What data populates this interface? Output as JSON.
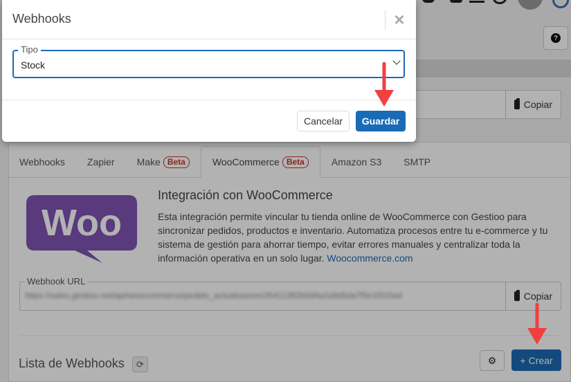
{
  "modal": {
    "title": "Webhooks",
    "close_symbol": "×",
    "type_legend": "Tipo",
    "type_value": "Stock",
    "cancel_label": "Cancelar",
    "save_label": "Guardar"
  },
  "background": {
    "copy_label": "Copiar",
    "help_symbol": "?",
    "tabs": [
      {
        "label": "Webhooks",
        "badge": ""
      },
      {
        "label": "Zapier",
        "badge": ""
      },
      {
        "label": "Make",
        "badge": "Beta"
      },
      {
        "label": "WooCommerce",
        "badge": "Beta"
      },
      {
        "label": "Amazon S3",
        "badge": ""
      },
      {
        "label": "SMTP",
        "badge": ""
      }
    ],
    "active_tab_index": 3,
    "integration": {
      "title": "Integración con WooCommerce",
      "description": "Esta integración permite vincular tu tienda online de WooCommerce con Gestioo para sincronizar pedidos, productos e inventario. Automatiza procesos entre tu e-commerce y tu sistema de gestión para ahorrar tiempo, evitar errores manuales y centralizar toda la información operativa en un solo lugar.",
      "link_text": "Woocommerce.com",
      "logo_text": "Woo"
    },
    "webhook_url": {
      "legend": "Webhook URL",
      "value": "https://sales.gestioo.net/api/woocommerce/pedido_actualizacion/35411382b0d4a2a9d5da7f5e1f315ed"
    },
    "list": {
      "title": "Lista de Webhooks",
      "create_label": "Crear"
    }
  },
  "colors": {
    "primary": "#1a6bb5",
    "beta_badge": "#c0392b",
    "woo_purple": "#7f54b3",
    "annotation_arrow": "#f04040"
  }
}
